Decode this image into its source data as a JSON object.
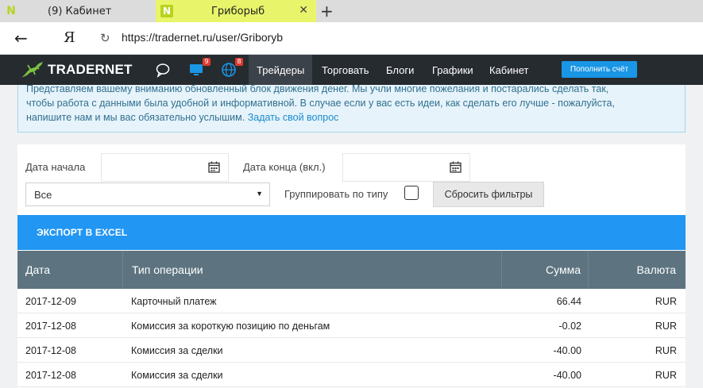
{
  "browser": {
    "tabs": [
      {
        "icon": "N",
        "label": "(9) Кабинет"
      },
      {
        "icon": "N",
        "label": "Гриборыб"
      }
    ],
    "new_tab": "+",
    "close": "✕",
    "back": "←",
    "ya": "Я",
    "reload": "↻",
    "url": "https://tradernet.ru/user/Griboryb"
  },
  "site_nav": {
    "logo": "TRADERNET",
    "badges": {
      "monitor": "9",
      "globe": "8"
    },
    "items": [
      "Трейдеры",
      "Торговать",
      "Блоги",
      "Графики",
      "Кабинет"
    ],
    "active_index": 0,
    "topup_label": "Пополнить счёт"
  },
  "notice": {
    "line1": "Представляем вашему вниманию обновленный блок движения денег. Мы учли многие пожелания и постарались сделать так,",
    "line2": "чтобы работа с данными была удобной и информативной. В случае если у вас есть идеи, как сделать его лучше - пожалуйста,",
    "line3": "напишите нам и мы вас обязательно услышим.",
    "link": "Задать свой вопрос"
  },
  "filters": {
    "start_label": "Дата начала",
    "end_label": "Дата конца (вкл.)",
    "start_value": "",
    "end_value": "",
    "type_select": "Все",
    "group_label": "Группировать по типу",
    "reset_label": "Сбросить фильтры"
  },
  "export_label": "ЭКСПОРТ В EXCEL",
  "table": {
    "columns": [
      "Дата",
      "Тип операции",
      "Сумма",
      "Валюта"
    ],
    "rows": [
      {
        "date": "2017-12-09",
        "type": "Карточный платеж",
        "amount": "66.44",
        "currency": "RUR"
      },
      {
        "date": "2017-12-08",
        "type": "Комиссия за короткую позицию по деньгам",
        "amount": "-0.02",
        "currency": "RUR"
      },
      {
        "date": "2017-12-08",
        "type": "Комиссия за сделки",
        "amount": "-40.00",
        "currency": "RUR"
      },
      {
        "date": "2017-12-08",
        "type": "Комиссия за сделки",
        "amount": "-40.00",
        "currency": "RUR"
      }
    ]
  },
  "colors": {
    "nav_bg": "#262b30",
    "accent": "#2196f3",
    "table_header": "#5d7480",
    "tab_active": "#e8f56a"
  }
}
